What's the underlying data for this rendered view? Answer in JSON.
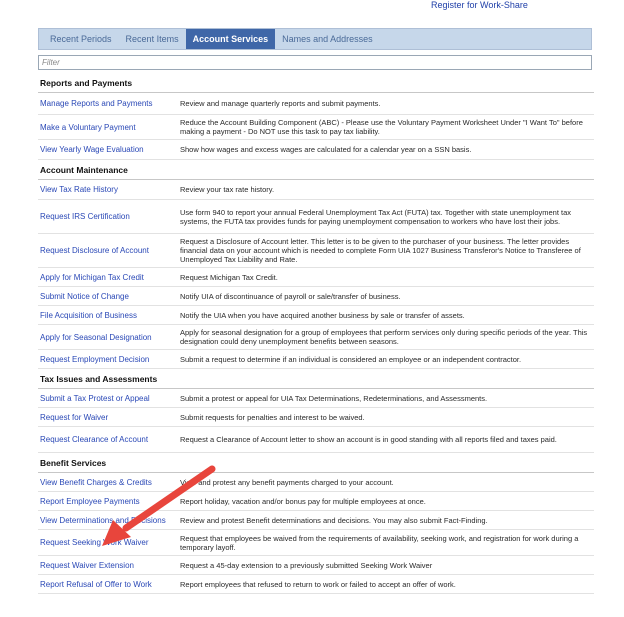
{
  "header": {
    "register_link": "Register for Work-Share"
  },
  "tabs": [
    {
      "label": "Recent Periods",
      "active": false
    },
    {
      "label": "Recent Items",
      "active": false
    },
    {
      "label": "Account Services",
      "active": true
    },
    {
      "label": "Names and Addresses",
      "active": false
    }
  ],
  "filter": {
    "placeholder": "Filter",
    "value": ""
  },
  "sections": [
    {
      "title": "Reports and Payments",
      "rows": [
        {
          "link": "Manage Reports and Payments",
          "desc": "Review and manage quarterly reports and submit payments."
        },
        {
          "link": "Make a Voluntary Payment",
          "desc": "Reduce the Account Building Component (ABC) - Please use the Voluntary Payment Worksheet Under \"I Want To\" before making a payment - Do NOT use this task to pay tax liability."
        },
        {
          "link": "View Yearly Wage Evaluation",
          "desc": "Show how wages and excess wages are calculated for a calendar year on a SSN basis."
        }
      ]
    },
    {
      "title": "Account Maintenance",
      "rows": [
        {
          "link": "View Tax Rate History",
          "desc": "Review your tax rate history."
        },
        {
          "link": "Request IRS Certification",
          "desc": "Use form 940 to report your annual Federal Unemployment Tax Act (FUTA) tax. Together with state unemployment tax systems, the FUTA tax provides funds for paying unemployment compensation to workers who have lost their jobs."
        },
        {
          "link": "Request Disclosure of Account",
          "desc": "Request a Disclosure of Account letter. This letter is to be given to the purchaser of your business. The letter provides financial data on your account which is needed to complete Form UIA 1027 Business Transferor's Notice to Transferee of Unemployed Tax Liability and Rate."
        },
        {
          "link": "Apply for Michigan Tax Credit",
          "desc": "Request Michigan Tax Credit."
        },
        {
          "link": "Submit Notice of Change",
          "desc": "Notify UIA of discontinuance of payroll or sale/transfer of business."
        },
        {
          "link": "File Acquisition of Business",
          "desc": "Notify the UIA when you have acquired another business by sale or transfer of assets."
        },
        {
          "link": "Apply for Seasonal Designation",
          "desc": "Apply for seasonal designation for a group of employees that perform services only during specific periods of the year. This designation could deny unemployment benefits between seasons."
        },
        {
          "link": "Request Employment Decision",
          "desc": "Submit a request to determine if an individual is considered an employee or an independent contractor."
        }
      ]
    },
    {
      "title": "Tax Issues and Assessments",
      "rows": [
        {
          "link": "Submit a Tax Protest or Appeal",
          "desc": "Submit a protest or appeal for UIA Tax Determinations, Redeterminations, and Assessments."
        },
        {
          "link": "Request for Waiver",
          "desc": "Submit requests for penalties and interest to be waived."
        },
        {
          "link": "Request Clearance of Account",
          "desc": "Request a Clearance of Account letter to show an account is in good standing with all reports filed and taxes paid."
        }
      ]
    },
    {
      "title": "Benefit Services",
      "rows": [
        {
          "link": "View Benefit Charges & Credits",
          "desc": "View and protest any benefit payments charged to your account."
        },
        {
          "link": "Report Employee Payments",
          "desc": "Report holiday, vacation and/or bonus pay for multiple employees at once."
        },
        {
          "link": "View Determinations and Decisions",
          "desc": "Review and protest Benefit determinations and decisions. You may also submit Fact-Finding."
        },
        {
          "link": "Request Seeking Work Waiver",
          "desc": "Request that employees be waived from the requirements of availability, seeking work, and registration for work during a temporary layoff."
        },
        {
          "link": "Request Waiver Extension",
          "desc": "Request a 45-day extension to a previously submitted Seeking Work Waiver"
        },
        {
          "link": "Report Refusal of Offer to Work",
          "desc": "Report employees that refused to return to work or failed to accept an offer of work."
        }
      ]
    }
  ],
  "annotation": {
    "arrow_color": "#e8453c"
  }
}
